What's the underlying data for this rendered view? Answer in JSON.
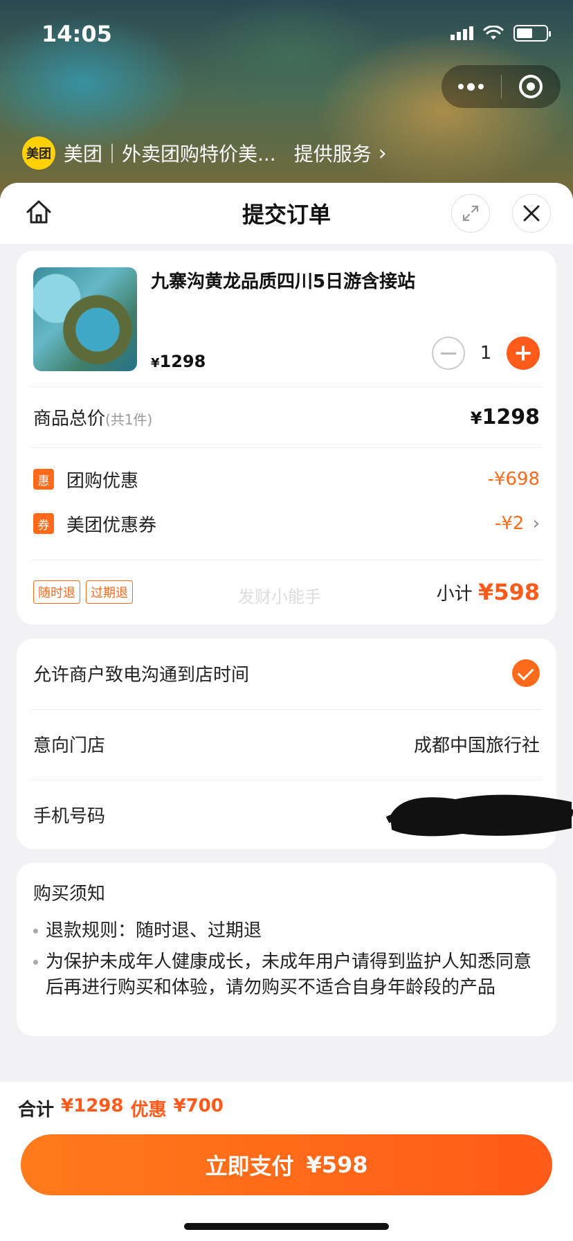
{
  "status_bar": {
    "time": "14:05"
  },
  "provider": {
    "logo_text": "美团",
    "name": "美团｜外卖团购特价美...",
    "service_label": "提供服务",
    "chevron": "›"
  },
  "header": {
    "title": "提交订单"
  },
  "product": {
    "title": "九寨沟黄龙品质四川5日游含接站",
    "price_yen": "¥",
    "price": "1298",
    "quantity": "1"
  },
  "pricing": {
    "total_label": "商品总价",
    "total_count": "(共1件)",
    "total_yen": "¥",
    "total_value": "1298",
    "discounts": [
      {
        "badge": "惠",
        "label": "团购优惠",
        "value": "-¥698",
        "chevron": ""
      },
      {
        "badge": "券",
        "label": "美团优惠券",
        "value": "-¥2",
        "chevron": "›"
      }
    ],
    "tags": [
      "随时退",
      "过期退"
    ],
    "watermark": "发财小能手",
    "subtotal_label": "小计",
    "subtotal_value": "¥598"
  },
  "info": {
    "allow_call_label": "允许商户致电沟通到店时间",
    "allow_call_checked": true,
    "store_label": "意向门店",
    "store_value": "成都中国旅行社",
    "phone_label": "手机号码"
  },
  "notice": {
    "title": "购买须知",
    "items": [
      "退款规则：随时退、过期退",
      "为保护未成年人健康成长，未成年用户请得到监护人知悉同意后再进行购买和体验，请勿购买不适合自身年龄段的产品"
    ]
  },
  "footer": {
    "total_label": "合计",
    "total_value": "¥1298",
    "discount_label": "优惠",
    "discount_value": "¥700",
    "pay_label": "立即支付",
    "pay_amount": "¥598"
  },
  "colors": {
    "accent": "#ff5a1a",
    "brand_yellow": "#ffd100"
  }
}
